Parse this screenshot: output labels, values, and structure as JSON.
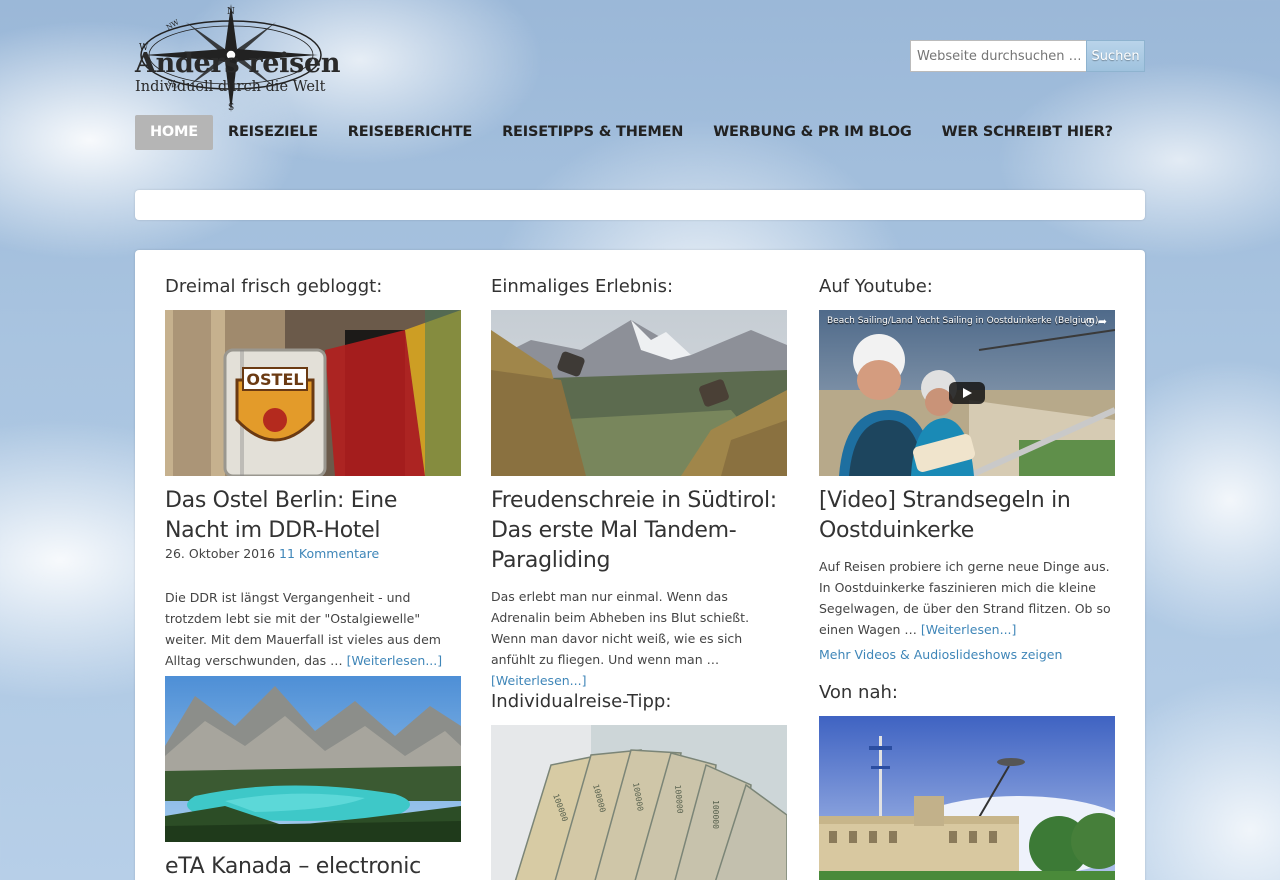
{
  "site": {
    "title": "Anders reisen",
    "tagline": "Individuell durch die Welt"
  },
  "search": {
    "placeholder": "Webseite durchsuchen …",
    "button_label": "Suchen"
  },
  "nav": {
    "items": [
      {
        "label": "HOME",
        "active": true
      },
      {
        "label": "REISEZIELE"
      },
      {
        "label": "REISEBERICHTE"
      },
      {
        "label": "REISETIPPS & THEMEN"
      },
      {
        "label": "WERBUNG & PR IM BLOG"
      },
      {
        "label": "WER SCHREIBT HIER?"
      }
    ]
  },
  "columns": {
    "col1": {
      "heading": "Dreimal frisch gebloggt:",
      "post1": {
        "title": "Das Ostel Berlin: Eine Nacht im DDR-Hotel",
        "date": "26. Oktober 2016",
        "comments": "11 Kommentare",
        "excerpt": "Die DDR ist längst Vergangenheit - und trotzdem lebt sie mit der \"Ostalgiewelle\" weiter. Mit dem Mauerfall ist vieles aus dem Alltag verschwunden, das …",
        "more": "[Weiterlesen...]",
        "sign_text": "OSTEL"
      },
      "post2": {
        "title": "eTA Kanada – electronic"
      }
    },
    "col2": {
      "heading": "Einmaliges Erlebnis:",
      "post1": {
        "title": "Freudenschreie in Südtirol: Das erste Mal Tandem-Paragliding",
        "excerpt": "Das erlebt man nur einmal. Wenn das Adrenalin beim Abheben ins Blut schießt. Wenn man davor nicht weiß, wie es sich anfühlt zu fliegen. Und wenn man …",
        "more": "[Weiterlesen...]"
      },
      "heading2": "Individualreise-Tipp:"
    },
    "col3": {
      "heading": "Auf Youtube:",
      "video": {
        "caption": "Beach Sailing/Land Yacht Sailing in Oostduinkerke (Belgium)",
        "title": "[Video] Strandsegeln in Oostduinkerke",
        "excerpt": "Auf Reisen probiere ich gerne neue Dinge aus. In Oostduinkerke faszinieren mich die kleine Segelwagen, de über den Strand flitzen. Ob so einen Wagen …",
        "more": "[Weiterlesen...]",
        "more_videos": "Mehr Videos & Audioslideshows zeigen"
      },
      "heading2": "Von nah:"
    }
  },
  "colors": {
    "link": "#3f86b8",
    "nav_active_bg": "#b5b5b5",
    "text": "#333333"
  }
}
